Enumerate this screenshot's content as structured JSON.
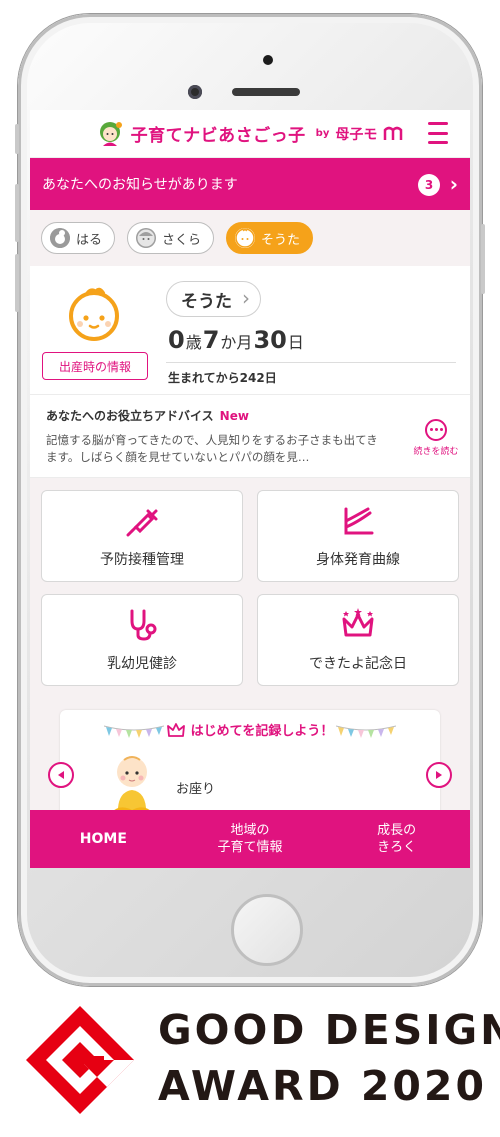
{
  "app": {
    "logo_text": "子育てナビあさごっ子",
    "logo_sub": "by",
    "logo_mark": "母子モ"
  },
  "notice": {
    "text": "あなたへのお知らせがあります",
    "count": "3"
  },
  "children": [
    {
      "name": "はる",
      "active": false
    },
    {
      "name": "さくら",
      "active": false
    },
    {
      "name": "そうた",
      "active": true
    }
  ],
  "profile": {
    "name": "そうた",
    "birth_info_label": "出産時の情報",
    "age": {
      "years": "0",
      "years_unit": "歳",
      "months": "7",
      "months_unit": "か月",
      "days": "30",
      "days_unit": "日"
    },
    "born_days": "生まれてから242日"
  },
  "advice": {
    "title": "あなたへのお役立ちアドバイス",
    "badge": "New",
    "body": "記憶する脳が育ってきたので、人見知りをするお子さまも出てきます。しばらく顔を見せていないとパパの顔を見…",
    "read_more": "続きを読む"
  },
  "menu": [
    {
      "label": "予防接種管理",
      "icon": "syringe-icon"
    },
    {
      "label": "身体発育曲線",
      "icon": "growth-curve-icon"
    },
    {
      "label": "乳幼児健診",
      "icon": "stethoscope-icon"
    },
    {
      "label": "できたよ記念日",
      "icon": "crown-icon"
    }
  ],
  "record": {
    "title": "はじめてを記録しよう！",
    "item": "お座り"
  },
  "tabs": [
    {
      "label": "HOME"
    },
    {
      "label": "地域の\n子育て情報"
    },
    {
      "label": "成長の\nきろく"
    }
  ],
  "award": {
    "line1": "GOOD DESIGN",
    "line2": "AWARD 2020"
  },
  "colors": {
    "accent": "#e0137f",
    "active_child": "#f5a21a",
    "award_red": "#e60012"
  }
}
